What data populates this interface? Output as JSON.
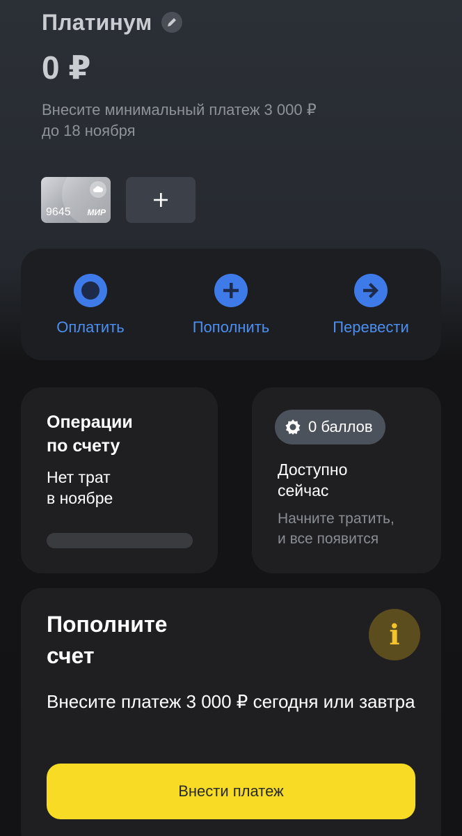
{
  "header": {
    "product_name": "Платинум",
    "balance": "0 ₽",
    "min_payment_line1": "Внесите минимальный платеж 3 000 ₽",
    "min_payment_line2": "до 18 ноября"
  },
  "cards": {
    "card_number": "9645",
    "card_brand": "МИР",
    "add_card_label": "+"
  },
  "actions": [
    {
      "label": "Оплатить",
      "icon": "circle-icon"
    },
    {
      "label": "Пополнить",
      "icon": "plus-icon"
    },
    {
      "label": "Перевести",
      "icon": "arrow-right-icon"
    }
  ],
  "operations": {
    "title_line1": "Операции",
    "title_line2": "по счету",
    "sub_line1": "Нет трат",
    "sub_line2": "в ноябре"
  },
  "bonus": {
    "pill_label": "0 баллов",
    "title_line1": "Доступно",
    "title_line2": "сейчас",
    "sub_line1": "Начните тратить,",
    "sub_line2": "и все появится"
  },
  "topup": {
    "title_line1": "Пополните",
    "title_line2": "счет",
    "info_glyph": "i",
    "text": "Внесите платеж 3 000 ₽ сегодня или завтра",
    "button_label": "Внести платеж"
  },
  "colors": {
    "accent_blue": "#3f7be8",
    "action_text_blue": "#4c8ff2",
    "button_yellow": "#f7db25",
    "info_yellow": "#f3c42e"
  }
}
